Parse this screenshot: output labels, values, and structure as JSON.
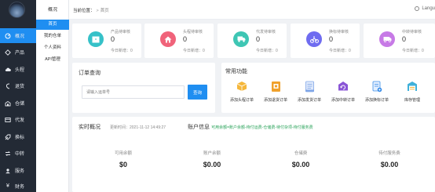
{
  "sidebar": {
    "items": [
      {
        "label": "概况",
        "icon": "dashboard-icon",
        "active": true
      },
      {
        "label": "产品",
        "icon": "product-icon",
        "active": false
      },
      {
        "label": "头程",
        "icon": "cloud-icon",
        "active": false
      },
      {
        "label": "退货",
        "icon": "return-icon",
        "active": false
      },
      {
        "label": "仓储",
        "icon": "warehouse-icon",
        "active": false
      },
      {
        "label": "代发",
        "icon": "truck-icon",
        "active": false
      },
      {
        "label": "换标",
        "icon": "label-icon",
        "active": false
      },
      {
        "label": "中转",
        "icon": "transfer-icon",
        "active": false
      },
      {
        "label": "服务",
        "icon": "service-icon",
        "active": false
      },
      {
        "label": "财务",
        "icon": "yen-icon",
        "active": false
      }
    ]
  },
  "subnav": {
    "title": "概况",
    "items": [
      {
        "label": "首页",
        "active": true
      },
      {
        "label": "我的仓单",
        "active": false
      },
      {
        "label": "个人资料",
        "active": false
      },
      {
        "label": "API管理",
        "active": false
      }
    ]
  },
  "header": {
    "breadcrumb_label": "当前位置：",
    "breadcrumb_current": "首页",
    "language": "Langu"
  },
  "stats": [
    {
      "label": "产品待审核",
      "value": "0",
      "today": "今日新增：0",
      "color": "#36c1c8",
      "icon": "box-icon"
    },
    {
      "label": "头程待审核",
      "value": "0",
      "today": "今日新增：0",
      "color": "#f0637a",
      "icon": "home-icon"
    },
    {
      "label": "代发待审核",
      "value": "0",
      "today": "今日新增：0",
      "color": "#3ec6b4",
      "icon": "truck-icon"
    },
    {
      "label": "换标待审核",
      "value": "0",
      "today": "今日新增：0",
      "color": "#6f6cf0",
      "icon": "bike-icon"
    },
    {
      "label": "中转待审核",
      "value": "0",
      "today": "今日新增：0",
      "color": "#c77ae6",
      "icon": "van-icon"
    }
  ],
  "order_query": {
    "title": "订单查询",
    "placeholder": "请输入运单号",
    "button": "查询"
  },
  "common_functions": {
    "title": "常用功能",
    "items": [
      {
        "label": "添加头程订单",
        "icon": "box-add-icon",
        "color": "#f5b73b"
      },
      {
        "label": "添加退货订单",
        "icon": "return-order-icon",
        "color": "#f0a12c"
      },
      {
        "label": "添加发货订单",
        "icon": "ship-order-icon",
        "color": "#7fa6e8"
      },
      {
        "label": "添加中转订单",
        "icon": "transfer-order-icon",
        "color": "#8a55d6"
      },
      {
        "label": "添加换标订单",
        "icon": "label-order-icon",
        "color": "#3b8ee8"
      },
      {
        "label": "库存管理",
        "icon": "inventory-icon",
        "color": "#3fb0d9"
      }
    ]
  },
  "overview": {
    "title": "实时概况",
    "update_time": "更新时间：2021-11-12 14:49:27",
    "account_title": "账户信息",
    "account_links": "可用余额=账户余额-待付运费-仓储费-待付杂项-待付服务费",
    "metrics": [
      {
        "label": "可用余额",
        "value": "$0"
      },
      {
        "label": "账户余额",
        "value": "$0.00"
      },
      {
        "label": "仓储费",
        "value": "$0.00"
      },
      {
        "label": "待付服务费",
        "value": "$0.00"
      }
    ]
  }
}
